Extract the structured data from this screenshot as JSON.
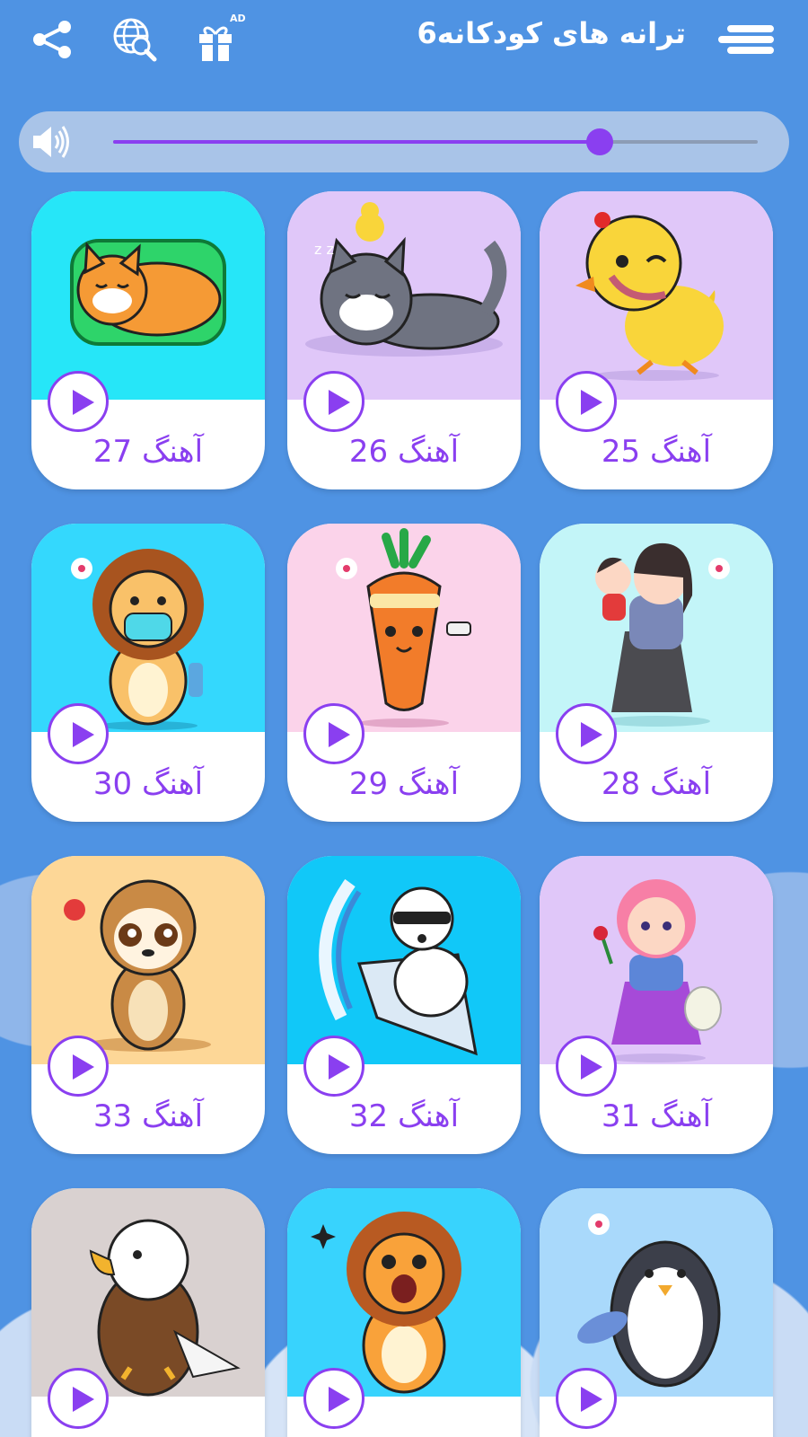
{
  "header": {
    "title": "ترانه های کودکانه6",
    "ad_badge": "AD",
    "icons": [
      "menu-icon",
      "gift-icon",
      "globe-search-icon",
      "share-icon"
    ]
  },
  "volume": {
    "level": 0.755,
    "icon": "speaker-icon"
  },
  "colors": {
    "accent": "#8a3ff0",
    "background": "#4f93e3"
  },
  "songs": [
    {
      "label": "آهنگ 25",
      "bg": "#e0c7f9",
      "art": "duckling"
    },
    {
      "label": "آهنگ 26",
      "bg": "#e0c7f9",
      "art": "sleeping-cat"
    },
    {
      "label": "آهنگ 27",
      "bg": "#26e6f8",
      "art": "cat-on-pillow"
    },
    {
      "label": "آهنگ 28",
      "bg": "#c3f5f8",
      "art": "mother-and-child"
    },
    {
      "label": "آهنگ 29",
      "bg": "#fbd3ea",
      "art": "carrot"
    },
    {
      "label": "آهنگ 30",
      "bg": "#34d8fd",
      "art": "lion-mask"
    },
    {
      "label": "آهنگ 31",
      "bg": "#e0c7f9",
      "art": "girl-with-rose"
    },
    {
      "label": "آهنگ 32",
      "bg": "#11c8f8",
      "art": "polar-bear-surfing"
    },
    {
      "label": "آهنگ 33",
      "bg": "#fdd797",
      "art": "meerkat"
    },
    {
      "label": "",
      "bg": "#a9d9fb",
      "art": "penguin"
    },
    {
      "label": "",
      "bg": "#38d3fd",
      "art": "lion-cheering"
    },
    {
      "label": "",
      "bg": "#d9d1d0",
      "art": "eagle"
    }
  ]
}
